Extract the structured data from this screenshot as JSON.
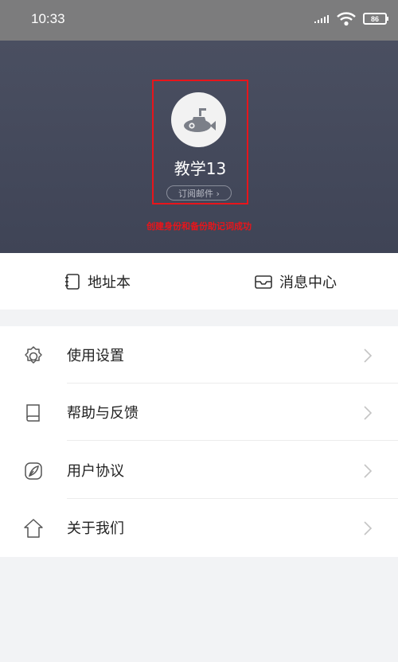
{
  "status": {
    "time": "10:33",
    "battery": "86"
  },
  "profile": {
    "name": "教学13",
    "subscribe_label": "订阅邮件 ›",
    "annotation": "创建身份和备份助记词成功"
  },
  "quick": {
    "address_book": "地址本",
    "message_center": "消息中心"
  },
  "menu": {
    "items": [
      {
        "label": "使用设置",
        "icon": "gear-icon"
      },
      {
        "label": "帮助与反馈",
        "icon": "book-icon"
      },
      {
        "label": "用户协议",
        "icon": "feather-icon"
      },
      {
        "label": "关于我们",
        "icon": "house-icon"
      }
    ]
  },
  "colors": {
    "header": "#464b5d",
    "highlight": "#e8151b"
  }
}
